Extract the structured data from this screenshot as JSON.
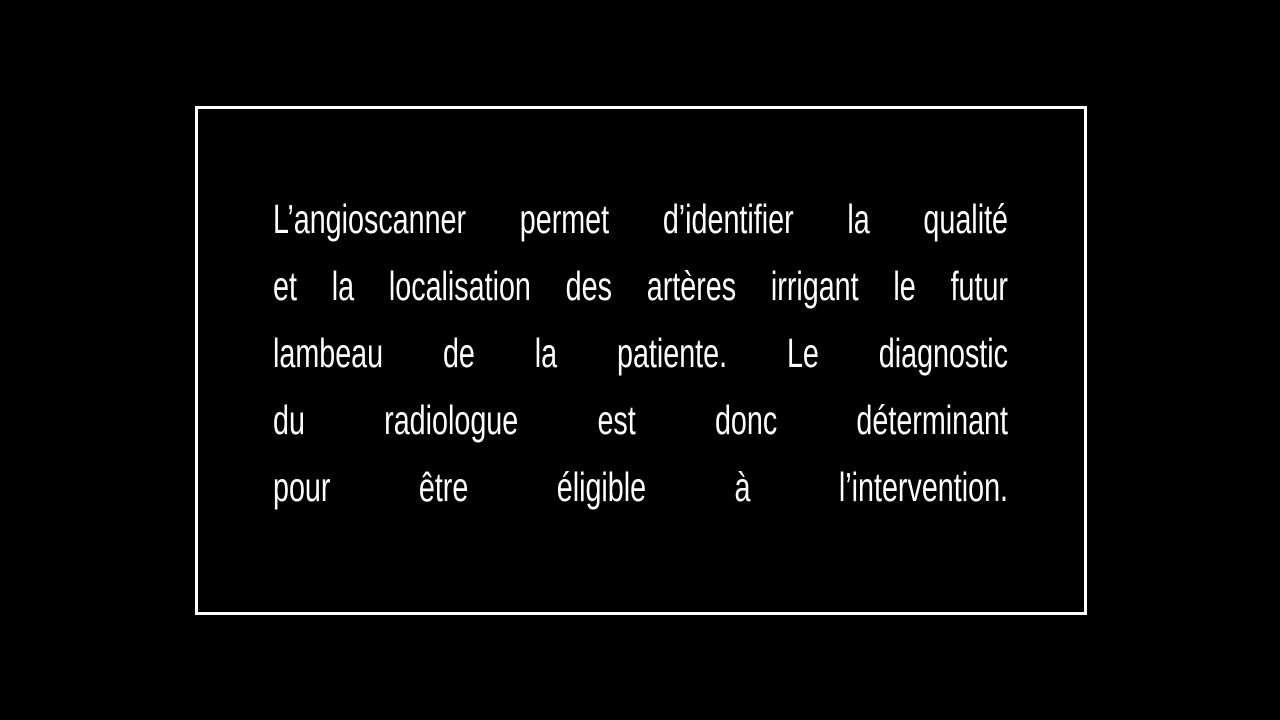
{
  "card": {
    "lines": [
      "L’angioscanner permet d’identifier la qualité",
      "et la localisation des artères irrigant le futur",
      "lambeau de la patiente. Le diagnostic",
      "du radiologue est donc déterminant",
      "pour être éligible à l’intervention."
    ]
  }
}
